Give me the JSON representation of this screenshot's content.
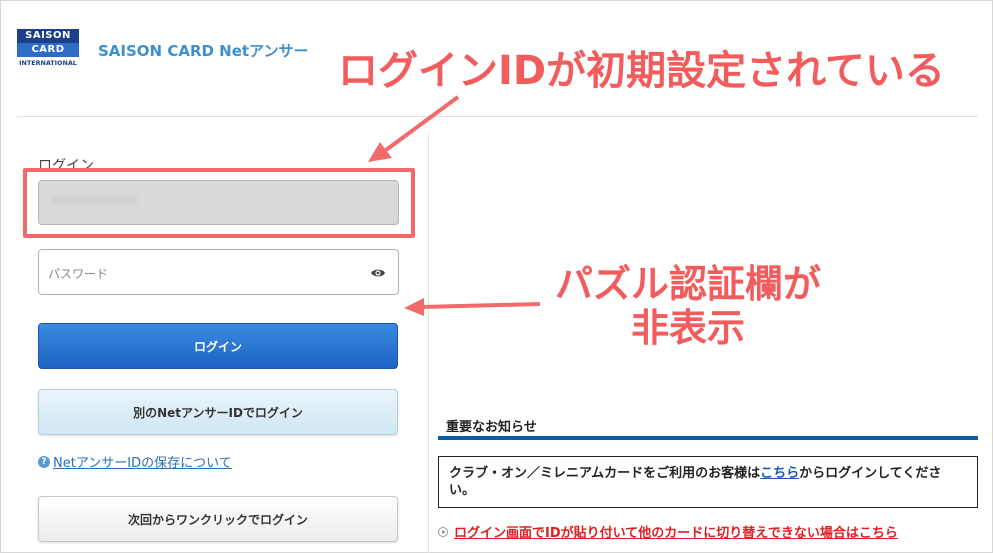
{
  "header": {
    "logo_top": "SAISON",
    "logo_mid": "CARD",
    "logo_bot": "INTERNATIONAL",
    "brand": "SAISON CARD Netアンサー"
  },
  "login": {
    "label": "ログイン",
    "id_value": "•••••••••••••",
    "password_placeholder": "パスワード",
    "login_button": "ログイン",
    "other_id_button": "別のNetアンサーIDでログイン",
    "help_link": "NetアンサーIDの保存について",
    "oneclick_button": "次回からワンクリックでログイン"
  },
  "notices": {
    "title": "重要なお知らせ",
    "box_text_before": "クラブ・オン／ミレニアムカードをご利用のお客様は",
    "box_link": "こちら",
    "box_text_after": "からログインしてください。",
    "link_text": "ログイン画面でIDが貼り付いて他のカードに切り替えできない場合はこちら"
  },
  "annotations": {
    "id_preset": "ログインIDが初期設定されている",
    "puzzle_hidden_line1": "パズル認証欄が",
    "puzzle_hidden_line2": "非表示",
    "color": "#f25c5c"
  },
  "icons": {
    "eye": "eye-icon",
    "help": "question-circle-icon",
    "bullet": "circle-arrow-icon"
  }
}
